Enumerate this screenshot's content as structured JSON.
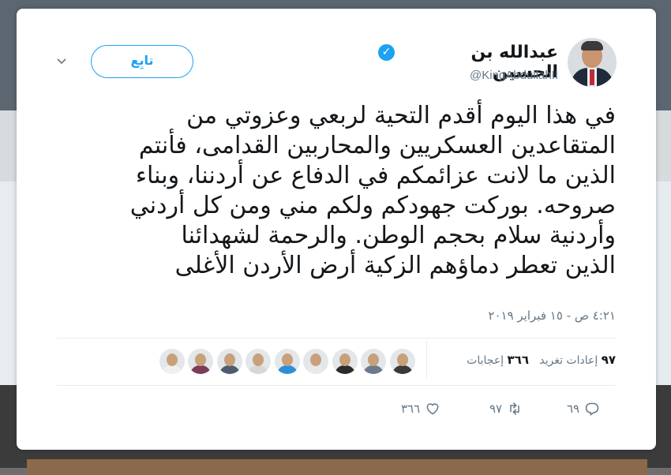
{
  "tweet": {
    "display_name": "عبدالله بن الحسين",
    "handle": "@KingAbdullahII",
    "follow_label": "تابِع",
    "text": "في هذا اليوم أقدم التحية لربعي وعزوتي من\nالمتقاعدين العسكريين والمحاربين القدامى، فأنتم\nالذين ما لانت عزائمكم في الدفاع عن أردننا، وبناء\nصروحه. بوركت جهودكم ولكم مني ومن كل أردني\nوأردنية سلام بحجم الوطن. والرحمة لشهدائنا\nالذين تعطر دماؤهم الزكية أرض الأردن الأغلى",
    "timestamp": "٤:٢١ ص - ١٥ فبراير ٢٠١٩",
    "retweets_count": "٩٧",
    "retweets_label": "إعادات تغريد",
    "likes_count": "٣٦٦",
    "likes_label": "إعجابات",
    "actions": {
      "reply_count": "٦٩",
      "retweet_count": "٩٧",
      "like_count": "٣٦٦"
    }
  },
  "icons": [
    "verified-badge-icon",
    "chevron-down-icon",
    "reply-icon",
    "retweet-icon",
    "heart-icon"
  ],
  "colors": {
    "accent": "#1da1f2",
    "text": "#14171a",
    "muted": "#657786"
  },
  "likers": [
    {
      "color": "#3a3a3a"
    },
    {
      "color": "#6b7b8c"
    },
    {
      "color": "#2b2b2b"
    },
    {
      "color": "#e9e9e9"
    },
    {
      "color": "#2d8fd6"
    },
    {
      "color": "#d7d7d7"
    },
    {
      "color": "#4d5d6d"
    },
    {
      "color": "#7b3d5a"
    },
    {
      "color": "#f0f0f0"
    }
  ]
}
